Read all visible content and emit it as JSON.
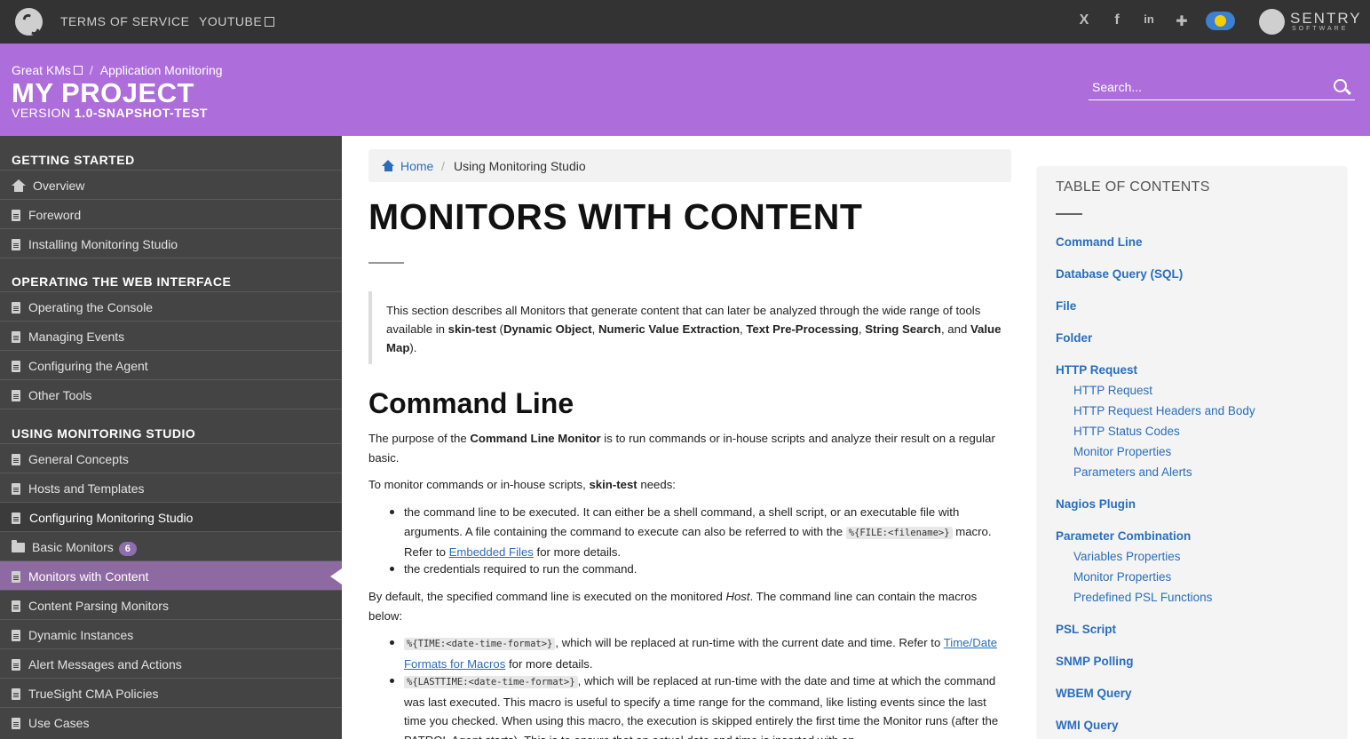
{
  "topbar": {
    "links": [
      "TERMS OF SERVICE",
      "YOUTUBE"
    ],
    "social_icons": [
      "x-icon",
      "facebook-icon",
      "linkedin-icon",
      "slack-icon",
      "weather-badge-icon"
    ],
    "brand_name": "SENTRY",
    "brand_sub": "SOFTWARE"
  },
  "header": {
    "crumb_parent": "Great KMs",
    "crumb_current": "Application Monitoring",
    "title": "MY PROJECT",
    "version_prefix": "VERSION ",
    "version": "1.0-SNAPSHOT-TEST",
    "search_placeholder": "Search..."
  },
  "sidebar": {
    "sections": [
      {
        "title": "GETTING STARTED",
        "items": [
          {
            "label": "Overview",
            "icon": "home-icon"
          },
          {
            "label": "Foreword",
            "icon": "file-icon"
          },
          {
            "label": "Installing Monitoring Studio",
            "icon": "file-icon"
          }
        ]
      },
      {
        "title": "OPERATING THE WEB INTERFACE",
        "items": [
          {
            "label": "Operating the Console",
            "icon": "file-icon"
          },
          {
            "label": "Managing Events",
            "icon": "file-icon"
          },
          {
            "label": "Configuring the Agent",
            "icon": "file-icon"
          },
          {
            "label": "Other Tools",
            "icon": "file-icon"
          }
        ]
      },
      {
        "title": "USING MONITORING STUDIO",
        "items": [
          {
            "label": "General Concepts",
            "icon": "file-icon"
          },
          {
            "label": "Hosts and Templates",
            "icon": "file-icon"
          },
          {
            "label": "Configuring Monitoring Studio",
            "icon": "file-icon",
            "state": "open"
          },
          {
            "label": "Basic Monitors",
            "icon": "folder-icon",
            "count": "6"
          },
          {
            "label": "Monitors with Content",
            "icon": "file-icon",
            "state": "active"
          },
          {
            "label": "Content Parsing Monitors",
            "icon": "file-icon"
          },
          {
            "label": "Dynamic Instances",
            "icon": "file-icon"
          },
          {
            "label": "Alert Messages and Actions",
            "icon": "file-icon"
          },
          {
            "label": "TrueSight CMA Policies",
            "icon": "file-icon"
          },
          {
            "label": "Use Cases",
            "icon": "file-icon"
          }
        ]
      }
    ]
  },
  "breadcrumb": {
    "home": "Home",
    "sep": "/",
    "current": "Using Monitoring Studio"
  },
  "main": {
    "title": "MONITORS WITH CONTENT",
    "intro": {
      "t1": "This section describes all Monitors that generate content that can later be analyzed through the wide range of tools available in ",
      "b1": "skin-test",
      "t2": " (",
      "b2": "Dynamic Object",
      "t3": ", ",
      "b3": "Numeric Value Extraction",
      "t4": ", ",
      "b4": "Text Pre-Processing",
      "t5": ", ",
      "b5": "String Search",
      "t6": ", and ",
      "b6": "Value Map",
      "t7": ")."
    },
    "section_title": "Command Line",
    "p1": {
      "t1": "The purpose of the ",
      "b1": "Command Line Monitor",
      "t2": " is to run commands or in-house scripts and analyze their result on a regular basic."
    },
    "p2": {
      "t1": "To monitor commands or in-house scripts, ",
      "b1": "skin-test",
      "t2": " needs:"
    },
    "bullet1": {
      "t1": "the command line to be executed. It can either be a shell command, a shell script, or an executable file with arguments. A file containing the command to execute can also be referred to with the ",
      "code": "%{FILE:<filename>}",
      "t2": " macro. Refer to ",
      "link": "Embedded Files",
      "t3": " for more details."
    },
    "bullet2": "the credentials required to run the command.",
    "p3": {
      "t1": "By default, the specified command line is executed on the monitored ",
      "i1": "Host",
      "t2": ". The command line can contain the macros below:"
    },
    "bullet3": {
      "code": "%{TIME:<date-time-format>}",
      "t1": ", which will be replaced at run-time with the current date and time. Refer to ",
      "link": "Time/Date Formats for Macros",
      "t2": " for more details."
    },
    "bullet4": {
      "code": "%{LASTTIME:<date-time-format>}",
      "t1": ", which will be replaced at run-time with the date and time at which the command was last executed. This macro is useful to specify a time range for the command, like listing events since the last time you checked. When using this macro, the execution is skipped entirely the first time the Monitor runs (after the PATROL Agent starts). This is to ensure that an actual date and time is inserted with an"
    }
  },
  "toc": {
    "title": "TABLE OF CONTENTS",
    "entries": [
      {
        "label": "Command Line",
        "level": 1
      },
      {
        "label": "Database Query (SQL)",
        "level": 1
      },
      {
        "label": "File",
        "level": 1
      },
      {
        "label": "Folder",
        "level": 1
      },
      {
        "label": "HTTP Request",
        "level": 1
      },
      {
        "label": "HTTP Request",
        "level": 2
      },
      {
        "label": "HTTP Request Headers and Body",
        "level": 2
      },
      {
        "label": "HTTP Status Codes",
        "level": 2
      },
      {
        "label": "Monitor Properties",
        "level": 2
      },
      {
        "label": "Parameters and Alerts",
        "level": 2
      },
      {
        "label": "Nagios Plugin",
        "level": 1
      },
      {
        "label": "Parameter Combination",
        "level": 1
      },
      {
        "label": "Variables Properties",
        "level": 2
      },
      {
        "label": "Monitor Properties",
        "level": 2
      },
      {
        "label": "Predefined PSL Functions",
        "level": 2
      },
      {
        "label": "PSL Script",
        "level": 1
      },
      {
        "label": "SNMP Polling",
        "level": 1
      },
      {
        "label": "WBEM Query",
        "level": 1
      },
      {
        "label": "WMI Query",
        "level": 1
      }
    ]
  },
  "colors": {
    "header": "#ad6edb",
    "topbar": "#333333",
    "sidebar": "#444444",
    "active": "#8e6aa3",
    "link": "#2a6ebb"
  }
}
